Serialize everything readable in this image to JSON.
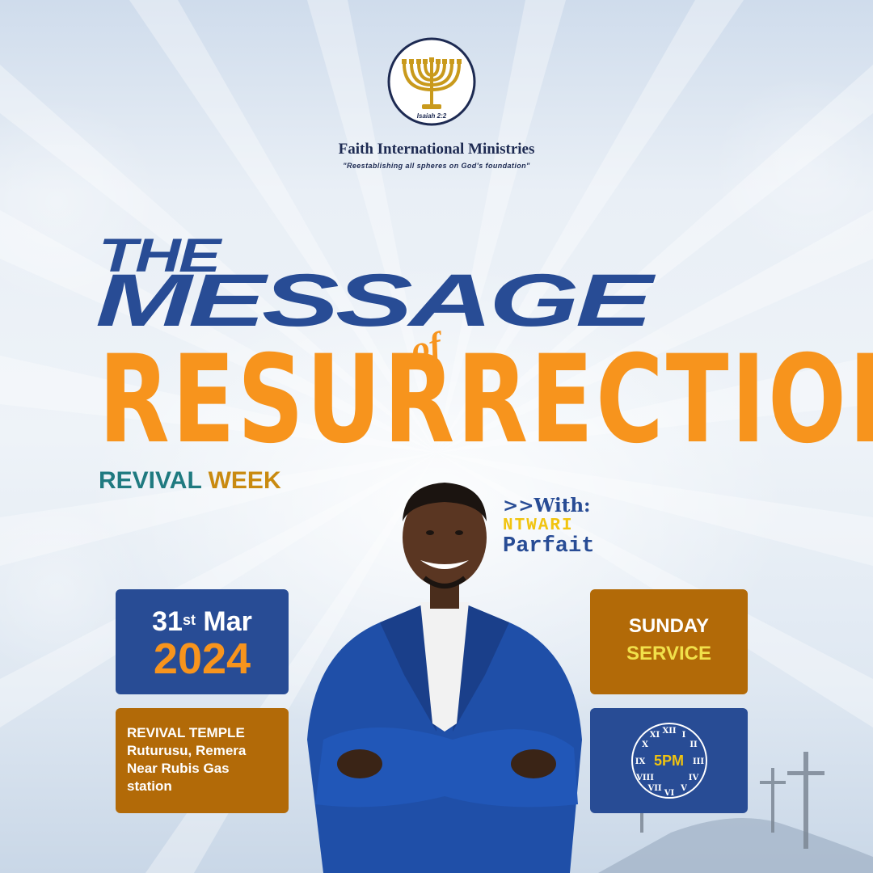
{
  "organization": {
    "logo_caption": "Isaiah 2:2",
    "name": "Faith International Ministries",
    "tagline": "\"Reestablishing all spheres on God's foundation\""
  },
  "headline": {
    "line1": "THE",
    "line2": "MESSAGE",
    "connector": "of",
    "line3": "RESURRECTION",
    "sub_part1": "REVIVAL",
    "sub_part2": "WEEK"
  },
  "speaker": {
    "intro": ">>With:",
    "first_name": "NTWARI",
    "last_name": "Parfait"
  },
  "event": {
    "day": "31",
    "day_suffix": "st",
    "month": "Mar",
    "year": "2024",
    "venue_lines": [
      "REVIVAL TEMPLE",
      "Ruturusu, Remera",
      "Near Rubis Gas",
      "station"
    ],
    "service_line1": "SUNDAY",
    "service_line2": "SERVICE",
    "time": "5PM"
  },
  "colors": {
    "navy": "#284c95",
    "orange": "#f7941d",
    "brown": "#b26a08",
    "teal": "#1f7a80",
    "gold": "#c98a10",
    "yellow": "#f1c40f"
  },
  "icons": [
    "menorah-icon",
    "clock-icon",
    "cross-icon"
  ]
}
